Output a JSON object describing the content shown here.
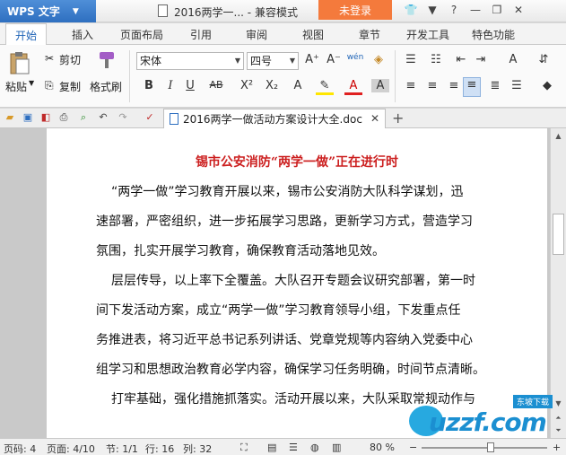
{
  "titlebar": {
    "app_label": "WPS 文字",
    "doc_title": "2016两学一...",
    "mode": "兼容模式",
    "login": "未登录",
    "icons": [
      "shirt-icon",
      "skin-icon",
      "help-icon",
      "minimize-icon",
      "restore-icon",
      "close-icon"
    ]
  },
  "tabs": [
    "开始",
    "插入",
    "页面布局",
    "引用",
    "审阅",
    "视图",
    "章节",
    "开发工具",
    "特色功能"
  ],
  "ribbon": {
    "paste": "粘贴",
    "cut": "剪切",
    "copy": "复制",
    "format_painter": "格式刷",
    "font_name": "宋体",
    "font_size": "四号",
    "bold": "B",
    "italic": "I",
    "underline": "U",
    "strike": "AB",
    "superscript": "X²",
    "subscript": "X₂",
    "grow": "A⁺",
    "shrink": "A⁻",
    "pinyin": "wén"
  },
  "doc_tab": {
    "name": "2016两学一做活动方案设计大全.doc"
  },
  "document": {
    "heading": "锡市公安消防“两学一做”正在进行时",
    "lines": [
      "“两学一做”学习教育开展以来，锡市公安消防大队科学谋划，迅",
      "速部署，严密组织，进一步拓展学习思路，更新学习方式，营造学习",
      "氛围，扎实开展学习教育，确保教育活动落地见效。",
      "层层传导，以上率下全覆盖。大队召开专题会议研究部署，第一时",
      "间下发活动方案，成立“两学一做”学习教育领导小组，下发重点任",
      "务推进表，将习近平总书记系列讲话、党章党规等内容纳入党委中心",
      "组学习和思想政治教育必学内容，确保学习任务明确，时间节点清晰。",
      "打牢基础，强化措施抓落实。活动开展以来，大队采取常规动作与"
    ]
  },
  "statusbar": {
    "page_code": "页码: 4",
    "page": "页面: 4/10",
    "section": "节: 1/1",
    "row": "行: 16",
    "col": "列: 32",
    "zoom": "80 %",
    "zoom_level": 0.55
  },
  "watermark": {
    "text": "uzzf.com",
    "sub": "东坡下载"
  }
}
